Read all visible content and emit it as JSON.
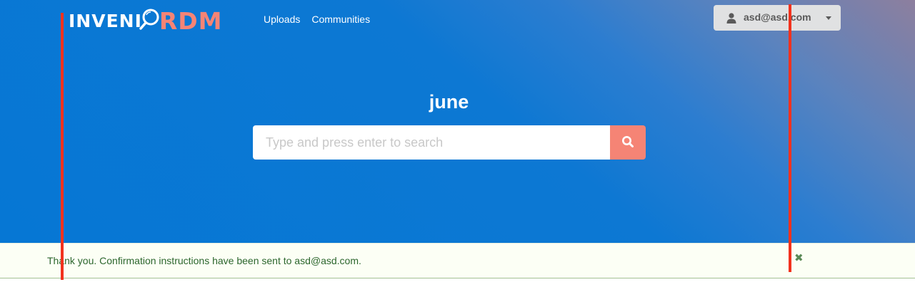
{
  "header": {
    "logo": {
      "part1": "INVENI",
      "part2": "RDM"
    },
    "nav": [
      {
        "label": "Uploads"
      },
      {
        "label": "Communities"
      }
    ],
    "user_menu": {
      "label": "asd@asd.com",
      "icon": "user-icon"
    }
  },
  "hero": {
    "title": "june",
    "search": {
      "placeholder": "Type and press enter to search",
      "value": "",
      "button_icon": "search-icon"
    }
  },
  "flash": {
    "message": "Thank you. Confirmation instructions have been sent to asd@asd.com.",
    "close_icon": "close-icon"
  },
  "colors": {
    "hero_blue": "#0677d4",
    "accent_coral": "#f58475",
    "flash_bg": "#fcfff5",
    "flash_text": "#2c662d",
    "annotation_red": "#f2321d"
  }
}
